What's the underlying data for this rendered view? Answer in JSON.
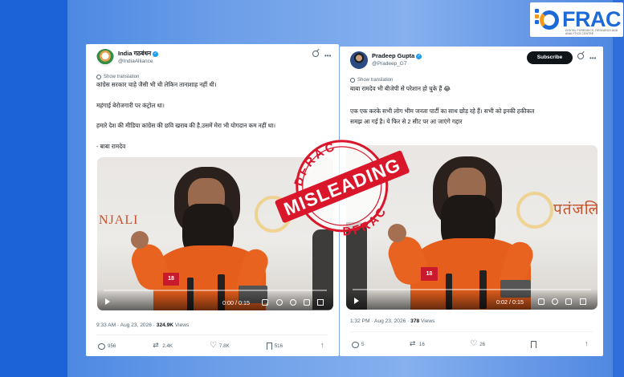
{
  "logo": {
    "text": "FRAC",
    "subtitle": "DIGITAL FORENSICS, RESEARCH AND ANALYTICS CENTRE"
  },
  "stamp": {
    "label": "MISLEADING",
    "top_text": "DFRAC",
    "bottom_text": "DFRAC",
    "color": "#d9162a"
  },
  "left_tweet": {
    "name": "India गठबंधन",
    "handle": "@IndiaAlliance",
    "show_translation": "Show translation",
    "lines": [
      "कांग्रेस सरकार चाहे जैसी भी थी लेकिन तानाशाह नहीं थी।",
      "महंगाई बेरोजगारी पर कंट्रोल था।",
      "हमारे देश की मीडिया कांग्रेस की छवि खराब की है,उसमें मेरा भी योगदान कम नहीं था।",
      "- बाबा रामदेव"
    ],
    "banner": "NJALI",
    "video_time": "0:00 / 0:15",
    "time": "9:33 AM · Aug 23, 2026 · ",
    "views": "324.9K",
    "views_label": " Views",
    "replies": "956",
    "reposts": "2.4K",
    "likes": "7.8K",
    "bookmarks": "516"
  },
  "right_tweet": {
    "name": "Pradeep Gupta",
    "handle": "@Pradeep_G7",
    "subscribe": "Subscribe",
    "show_translation": "Show translation",
    "lines": [
      "बाबा रामदेव भी बीजेपी से परेशान हो चुके हैं 😂",
      "एक एक करके सभी लोग भीम जनता पार्टी का साथ छोड़ रहे हैं। सभी को इनकी हकीकत",
      "समझ आ गई है। ये फिर से 2 सीट पर आ जाएंगे गद्दार"
    ],
    "banner": "पतंजलि",
    "video_time": "0:02 / 0:15",
    "time": "1:32 PM · Aug 23, 2026 · ",
    "views": "378",
    "views_label": " Views",
    "replies": "5",
    "reposts": "16",
    "likes": "26"
  },
  "mic_label": "18",
  "colors": {
    "accent": "#1d9bf0",
    "stamp": "#d9162a",
    "robe": "#e55e1c"
  }
}
